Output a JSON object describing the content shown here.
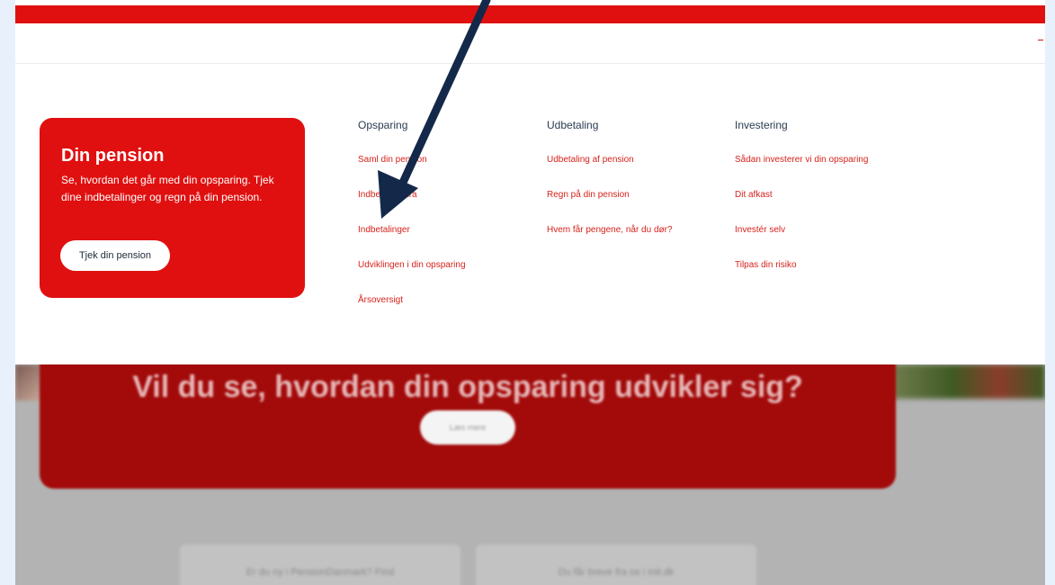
{
  "promo": {
    "title": "Din pension",
    "text": "Se, hvordan det går med din opsparing. Tjek dine indbetalinger og regn på din pension.",
    "button_label": "Tjek din pension"
  },
  "menu": {
    "col_opsparing": {
      "heading": "Opsparing",
      "links": [
        "Saml din pension",
        "Indbetal ekstra",
        "Indbetalinger",
        "Udviklingen i din opsparing",
        "Årsoversigt"
      ]
    },
    "col_udbetaling": {
      "heading": "Udbetaling",
      "links": [
        "Udbetaling af pension",
        "Regn på din pension",
        "Hvem får pengene, når du dør?"
      ]
    },
    "col_investering": {
      "heading": "Investering",
      "links": [
        "Sådan investerer vi din opsparing",
        "Dit afkast",
        "Investér selv",
        "Tilpas din risiko"
      ]
    }
  },
  "banner": {
    "title": "Vil du se, hvordan din opsparing udvikler sig?",
    "button_label": "Læs mere"
  },
  "cards": [
    {
      "text": "Er du ny i PensionDanmark? Find"
    },
    {
      "text": "Du får breve fra os i mit.dk"
    }
  ],
  "colors": {
    "brand_red": "#e01010",
    "banner_red": "#a30a0a",
    "link_red": "#d6231c",
    "arrow_navy": "#14294a"
  },
  "annotation": {
    "icon": "arrow-icon"
  }
}
